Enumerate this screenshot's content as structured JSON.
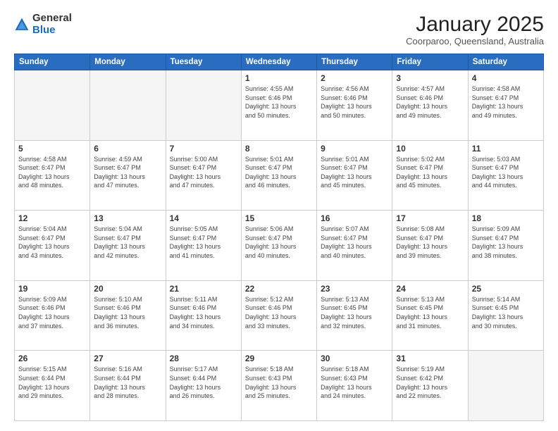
{
  "logo": {
    "general": "General",
    "blue": "Blue"
  },
  "title": "January 2025",
  "subtitle": "Coorparoo, Queensland, Australia",
  "weekdays": [
    "Sunday",
    "Monday",
    "Tuesday",
    "Wednesday",
    "Thursday",
    "Friday",
    "Saturday"
  ],
  "weeks": [
    [
      {
        "day": "",
        "info": ""
      },
      {
        "day": "",
        "info": ""
      },
      {
        "day": "",
        "info": ""
      },
      {
        "day": "1",
        "info": "Sunrise: 4:55 AM\nSunset: 6:46 PM\nDaylight: 13 hours\nand 50 minutes."
      },
      {
        "day": "2",
        "info": "Sunrise: 4:56 AM\nSunset: 6:46 PM\nDaylight: 13 hours\nand 50 minutes."
      },
      {
        "day": "3",
        "info": "Sunrise: 4:57 AM\nSunset: 6:46 PM\nDaylight: 13 hours\nand 49 minutes."
      },
      {
        "day": "4",
        "info": "Sunrise: 4:58 AM\nSunset: 6:47 PM\nDaylight: 13 hours\nand 49 minutes."
      }
    ],
    [
      {
        "day": "5",
        "info": "Sunrise: 4:58 AM\nSunset: 6:47 PM\nDaylight: 13 hours\nand 48 minutes."
      },
      {
        "day": "6",
        "info": "Sunrise: 4:59 AM\nSunset: 6:47 PM\nDaylight: 13 hours\nand 47 minutes."
      },
      {
        "day": "7",
        "info": "Sunrise: 5:00 AM\nSunset: 6:47 PM\nDaylight: 13 hours\nand 47 minutes."
      },
      {
        "day": "8",
        "info": "Sunrise: 5:01 AM\nSunset: 6:47 PM\nDaylight: 13 hours\nand 46 minutes."
      },
      {
        "day": "9",
        "info": "Sunrise: 5:01 AM\nSunset: 6:47 PM\nDaylight: 13 hours\nand 45 minutes."
      },
      {
        "day": "10",
        "info": "Sunrise: 5:02 AM\nSunset: 6:47 PM\nDaylight: 13 hours\nand 45 minutes."
      },
      {
        "day": "11",
        "info": "Sunrise: 5:03 AM\nSunset: 6:47 PM\nDaylight: 13 hours\nand 44 minutes."
      }
    ],
    [
      {
        "day": "12",
        "info": "Sunrise: 5:04 AM\nSunset: 6:47 PM\nDaylight: 13 hours\nand 43 minutes."
      },
      {
        "day": "13",
        "info": "Sunrise: 5:04 AM\nSunset: 6:47 PM\nDaylight: 13 hours\nand 42 minutes."
      },
      {
        "day": "14",
        "info": "Sunrise: 5:05 AM\nSunset: 6:47 PM\nDaylight: 13 hours\nand 41 minutes."
      },
      {
        "day": "15",
        "info": "Sunrise: 5:06 AM\nSunset: 6:47 PM\nDaylight: 13 hours\nand 40 minutes."
      },
      {
        "day": "16",
        "info": "Sunrise: 5:07 AM\nSunset: 6:47 PM\nDaylight: 13 hours\nand 40 minutes."
      },
      {
        "day": "17",
        "info": "Sunrise: 5:08 AM\nSunset: 6:47 PM\nDaylight: 13 hours\nand 39 minutes."
      },
      {
        "day": "18",
        "info": "Sunrise: 5:09 AM\nSunset: 6:47 PM\nDaylight: 13 hours\nand 38 minutes."
      }
    ],
    [
      {
        "day": "19",
        "info": "Sunrise: 5:09 AM\nSunset: 6:46 PM\nDaylight: 13 hours\nand 37 minutes."
      },
      {
        "day": "20",
        "info": "Sunrise: 5:10 AM\nSunset: 6:46 PM\nDaylight: 13 hours\nand 36 minutes."
      },
      {
        "day": "21",
        "info": "Sunrise: 5:11 AM\nSunset: 6:46 PM\nDaylight: 13 hours\nand 34 minutes."
      },
      {
        "day": "22",
        "info": "Sunrise: 5:12 AM\nSunset: 6:46 PM\nDaylight: 13 hours\nand 33 minutes."
      },
      {
        "day": "23",
        "info": "Sunrise: 5:13 AM\nSunset: 6:45 PM\nDaylight: 13 hours\nand 32 minutes."
      },
      {
        "day": "24",
        "info": "Sunrise: 5:13 AM\nSunset: 6:45 PM\nDaylight: 13 hours\nand 31 minutes."
      },
      {
        "day": "25",
        "info": "Sunrise: 5:14 AM\nSunset: 6:45 PM\nDaylight: 13 hours\nand 30 minutes."
      }
    ],
    [
      {
        "day": "26",
        "info": "Sunrise: 5:15 AM\nSunset: 6:44 PM\nDaylight: 13 hours\nand 29 minutes."
      },
      {
        "day": "27",
        "info": "Sunrise: 5:16 AM\nSunset: 6:44 PM\nDaylight: 13 hours\nand 28 minutes."
      },
      {
        "day": "28",
        "info": "Sunrise: 5:17 AM\nSunset: 6:44 PM\nDaylight: 13 hours\nand 26 minutes."
      },
      {
        "day": "29",
        "info": "Sunrise: 5:18 AM\nSunset: 6:43 PM\nDaylight: 13 hours\nand 25 minutes."
      },
      {
        "day": "30",
        "info": "Sunrise: 5:18 AM\nSunset: 6:43 PM\nDaylight: 13 hours\nand 24 minutes."
      },
      {
        "day": "31",
        "info": "Sunrise: 5:19 AM\nSunset: 6:42 PM\nDaylight: 13 hours\nand 22 minutes."
      },
      {
        "day": "",
        "info": ""
      }
    ]
  ]
}
